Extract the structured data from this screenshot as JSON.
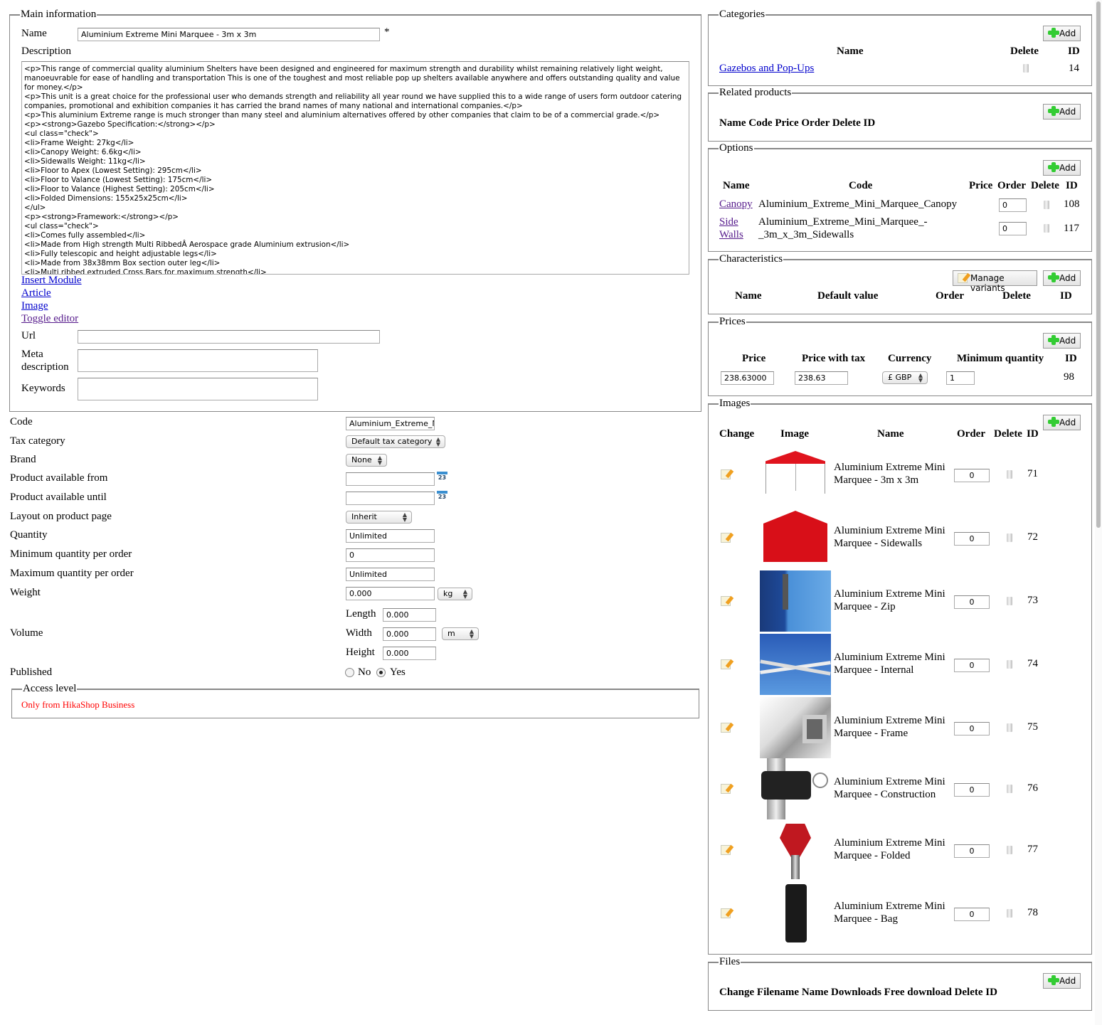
{
  "main": {
    "legend": "Main information",
    "name_label": "Name",
    "name_value": "Aluminium Extreme Mini Marquee - 3m x 3m",
    "required": "*",
    "description_label": "Description",
    "description_value": "<p>This range of commercial quality aluminium Shelters have been designed and engineered for maximum strength and durability whilst remaining relatively light weight, manoeuvrable for ease of handling and transportation This is one of the toughest and most reliable pop up shelters available anywhere and offers outstanding quality and value for money.</p>\n<p>This unit is a great choice for the professional user who demands strength and reliability all year round we have supplied this to a wide range of users form outdoor catering companies, promotional and exhibition companies it has carried the brand names of many national and international companies.</p>\n<p>This aluminium Extreme range is much stronger than many steel and aluminium alternatives offered by other companies that claim to be of a commercial grade.</p>\n<p><strong>Gazebo Specification:</strong></p>\n<ul class=\"check\">\n<li>Frame Weight: 27kg</li>\n<li>Canopy Weight: 6.6kg</li>\n<li>Sidewalls Weight: 11kg</li>\n<li>Floor to Apex (Lowest Setting): 295cm</li>\n<li>Floor to Valance (Lowest Setting): 175cm</li>\n<li>Floor to Valance (Highest Setting): 205cm</li>\n<li>Folded Dimensions: 155x25x25cm</li>\n</ul>\n<p><strong>Framework:</strong></p>\n<ul class=\"check\">\n<li>Comes fully assembled</li>\n<li>Made from High strength Multi RibbedÂ Aerospace grade Aluminium extrusion</li>\n<li>Fully telescopic and height adjustable legs</li>\n<li>Made from 38x38mm Box section outer leg</li>\n<li>Multi ribbed extruded Cross Bars for maximum strength</li>",
    "links": [
      "Insert Module",
      "Article",
      "Image",
      "Toggle editor"
    ],
    "url_label": "Url",
    "url_value": "",
    "meta_label": "Meta description",
    "meta_value": "",
    "keywords_label": "Keywords",
    "keywords_value": ""
  },
  "form": {
    "code_label": "Code",
    "code_value": "Aluminium_Extreme_Mini_Marquee",
    "tax_label": "Tax category",
    "tax_value": "Default tax category",
    "brand_label": "Brand",
    "brand_value": "None",
    "from_label": "Product available from",
    "until_label": "Product available until",
    "calendar_text": "23",
    "layout_label": "Layout on product page",
    "layout_value": "Inherit",
    "qty_label": "Quantity",
    "qty_value": "Unlimited",
    "minq_label": "Minimum quantity per order",
    "minq_value": "0",
    "maxq_label": "Maximum quantity per order",
    "maxq_value": "Unlimited",
    "weight_label": "Weight",
    "weight_value": "0.000",
    "weight_unit": "kg",
    "volume_label": "Volume",
    "length_label": "Length",
    "length_value": "0.000",
    "width_label": "Width",
    "width_value": "0.000",
    "height_label": "Height",
    "height_value": "0.000",
    "dim_unit": "m",
    "published_label": "Published",
    "published_no": "No",
    "published_yes": "Yes",
    "published_selected": "Yes",
    "access_legend": "Access level",
    "access_text": "Only from HikaShop Business",
    "access_color": "#ff0000"
  },
  "add_label": "Add",
  "categories": {
    "legend": "Categories",
    "headers": [
      "Name",
      "Delete",
      "ID"
    ],
    "rows": [
      {
        "name": "Gazebos and Pop-Ups",
        "id": "14"
      }
    ]
  },
  "related": {
    "legend": "Related products",
    "headers": "Name Code Price Order Delete ID"
  },
  "options": {
    "legend": "Options",
    "headers": [
      "Name",
      "Code",
      "Price",
      "Order",
      "Delete",
      "ID"
    ],
    "rows": [
      {
        "name": "Canopy",
        "code": "Aluminium_Extreme_Mini_Marquee_Canopy",
        "order": "0",
        "id": "108"
      },
      {
        "name1": "Side",
        "name2": "Walls",
        "code1": "Aluminium_Extreme_Mini_Marquee_-",
        "code2": "_3m_x_3m_Sidewalls",
        "order": "0",
        "id": "117"
      }
    ]
  },
  "characteristics": {
    "legend": "Characteristics",
    "manage_label": "Manage variants",
    "headers": [
      "Name",
      "Default value",
      "Order",
      "Delete",
      "ID"
    ]
  },
  "prices": {
    "legend": "Prices",
    "headers": [
      "Price",
      "Price with tax",
      "Currency",
      "Minimum quantity",
      "ID"
    ],
    "row": {
      "price": "238.63000",
      "price_tax": "238.63",
      "currency": "£ GBP",
      "min_qty": "1",
      "id": "98"
    }
  },
  "images": {
    "legend": "Images",
    "headers": [
      "Change",
      "Image",
      "Name",
      "Order",
      "Delete",
      "ID"
    ],
    "rows": [
      {
        "line1": "Aluminium Extreme Mini",
        "line2": "Marquee - 3m x 3m",
        "order": "0",
        "id": "71"
      },
      {
        "line1": "Aluminium Extreme Mini",
        "line2": "Marquee - Sidewalls",
        "order": "0",
        "id": "72"
      },
      {
        "line1": "Aluminium Extreme Mini",
        "line2": "Marquee - Zip",
        "order": "0",
        "id": "73"
      },
      {
        "line1": "Aluminium Extreme Mini",
        "line2": "Marquee - Internal",
        "order": "0",
        "id": "74"
      },
      {
        "line1": "Aluminium Extreme Mini",
        "line2": "Marquee - Frame",
        "order": "0",
        "id": "75"
      },
      {
        "line1": "Aluminium Extreme Mini",
        "line2": "Marquee - Construction",
        "order": "0",
        "id": "76"
      },
      {
        "line1": "Aluminium Extreme Mini",
        "line2": "Marquee - Folded",
        "order": "0",
        "id": "77"
      },
      {
        "line1": "Aluminium Extreme Mini",
        "line2": "Marquee - Bag",
        "order": "0",
        "id": "78"
      }
    ]
  },
  "files": {
    "legend": "Files",
    "headers": "Change Filename Name Downloads Free download Delete ID"
  }
}
